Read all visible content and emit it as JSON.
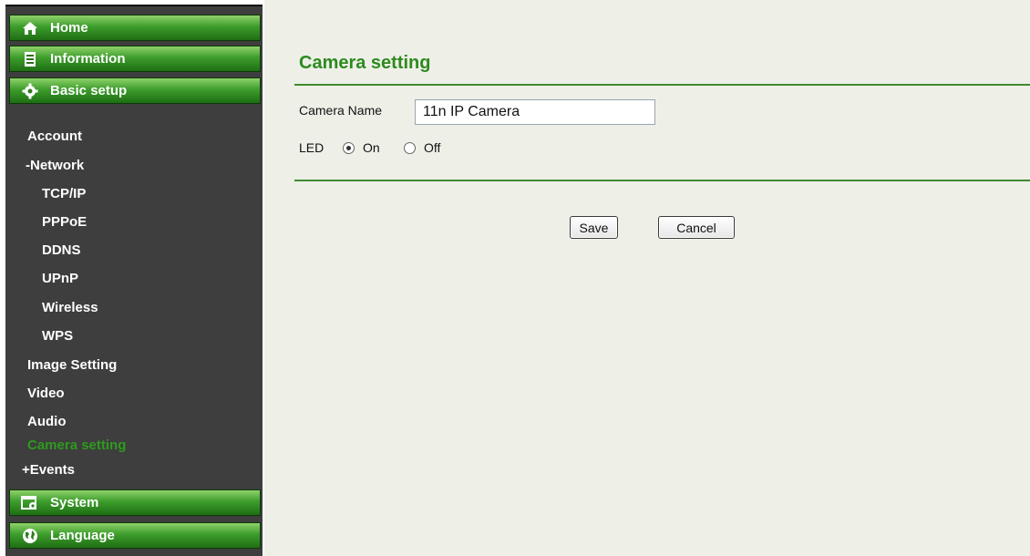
{
  "sidebar": {
    "headers": {
      "home": "Home",
      "information": "Information",
      "basic_setup": "Basic setup",
      "system": "System",
      "language": "Language"
    },
    "items": {
      "account": "Account",
      "network": "-Network",
      "tcpip": "TCP/IP",
      "pppoe": "PPPoE",
      "ddns": "DDNS",
      "upnp": "UPnP",
      "wireless": "Wireless",
      "wps": "WPS",
      "image_setting": "Image Setting",
      "video": "Video",
      "audio": "Audio",
      "camera_setting": "Camera setting",
      "events": "+Events"
    }
  },
  "main": {
    "title": "Camera setting",
    "camera_name_label": "Camera Name",
    "camera_name_value": "11n IP Camera",
    "led_label": "LED",
    "led_on_label": "On",
    "led_off_label": "Off",
    "led_selected": "On",
    "save_label": "Save",
    "cancel_label": "Cancel"
  },
  "colors": {
    "header_green": "#3d9d2c",
    "title_green": "#2e8a1e",
    "active_item": "#2e9a1e",
    "sidebar_bg": "#3e3e3e",
    "content_bg": "#eef0e8"
  }
}
